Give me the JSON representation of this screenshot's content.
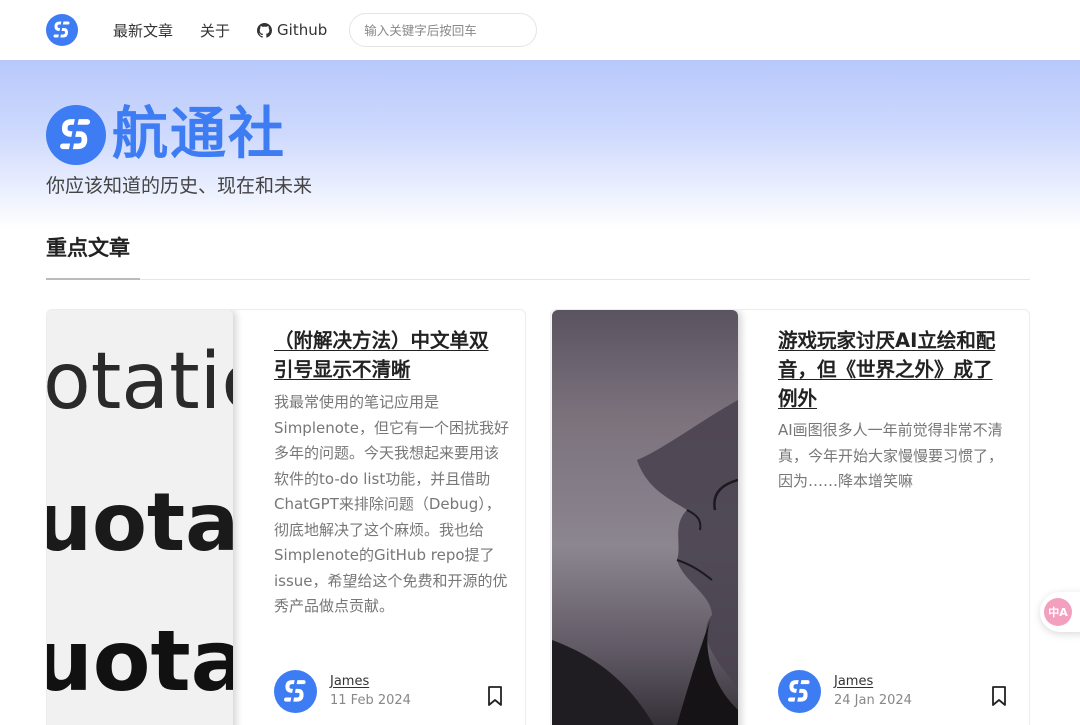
{
  "nav": {
    "logo_icon": "site-logo-icon",
    "links": [
      {
        "label": "最新文章"
      },
      {
        "label": "关于"
      },
      {
        "label": "Github",
        "icon": "github-icon"
      }
    ],
    "search_placeholder": "输入关键字后按回车"
  },
  "hero": {
    "brand_name": "航通社",
    "tagline": "你应该知道的历史、现在和未来"
  },
  "section": {
    "title": "重点文章"
  },
  "articles": [
    {
      "title": "（附解决方法）中文单双引号显示不清晰",
      "excerpt": "我最常使用的笔记应用是Simplenote，但它有一个困扰我好多年的问题。今天我想起来要用该软件的to-do list功能，并且借助ChatGPT来排除问题（Debug），彻底地解决了这个麻烦。我也给Simplenote的GitHub repo提了issue，希望给这个免费和开源的优秀产品做点贡献。",
      "image_text": [
        "otatic",
        "uotati",
        "uotat"
      ],
      "author": "James",
      "date": "11 Feb 2024"
    },
    {
      "title": "游戏玩家讨厌AI立绘和配音，但《世界之外》成了例外",
      "excerpt": "AI画图很多人一年前觉得非常不清真，今年开始大家慢慢要习惯了，因为……降本增笑嘛",
      "author": "James",
      "date": "24 Jan 2024"
    }
  ],
  "colors": {
    "brand_blue": "#3d7cf2",
    "hero_top": "#b7c8fb"
  },
  "translate_badge": "中A"
}
